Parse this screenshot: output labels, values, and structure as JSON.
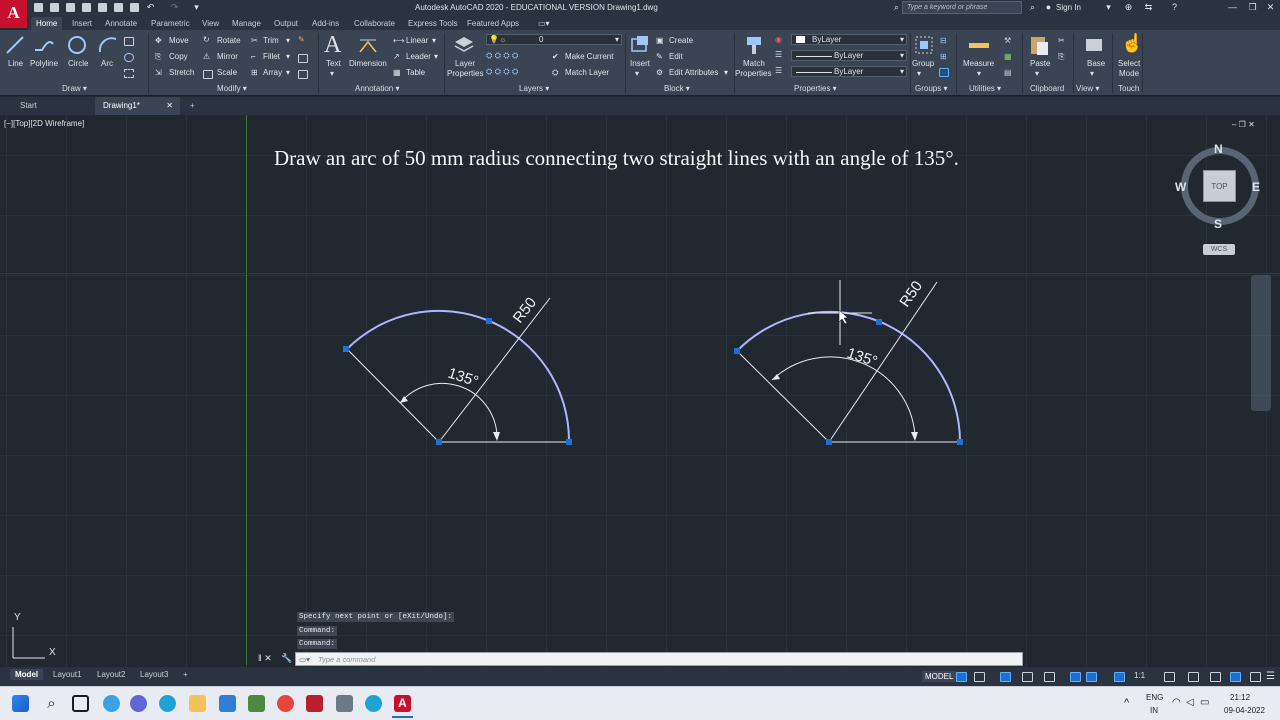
{
  "window": {
    "title": "Autodesk AutoCAD 2020 - EDUCATIONAL VERSION    Drawing1.dwg",
    "search_placeholder": "Type a keyword or phrase",
    "sign_in": "Sign In",
    "logo": "A"
  },
  "ribbon_tabs": [
    "Home",
    "Insert",
    "Annotate",
    "Parametric",
    "View",
    "Manage",
    "Output",
    "Add-ins",
    "Collaborate",
    "Express Tools",
    "Featured Apps"
  ],
  "ribbon": {
    "draw": {
      "line": "Line",
      "polyline": "Polyline",
      "circle": "Circle",
      "arc": "Arc",
      "panel": "Draw ▾"
    },
    "modify": {
      "move": "Move",
      "rotate": "Rotate",
      "trim": "Trim",
      "copy": "Copy",
      "mirror": "Mirror",
      "fillet": "Fillet",
      "stretch": "Stretch",
      "scale": "Scale",
      "array": "Array",
      "panel": "Modify ▾"
    },
    "annotation": {
      "text": "Text",
      "dimension": "Dimension",
      "linear": "Linear",
      "leader": "Leader",
      "table": "Table",
      "panel": "Annotation ▾"
    },
    "layers": {
      "layer_properties_1": "Layer",
      "layer_properties_2": "Properties",
      "layer_value": "0",
      "make_current": "Make Current",
      "match_layer": "Match Layer",
      "panel": "Layers ▾"
    },
    "block": {
      "insert": "Insert",
      "create": "Create",
      "edit": "Edit",
      "edit_attributes": "Edit Attributes",
      "panel": "Block ▾"
    },
    "properties": {
      "match_1": "Match",
      "match_2": "Properties",
      "color": "ByLayer",
      "linetype": "ByLayer",
      "lineweight": "ByLayer",
      "panel": "Properties ▾"
    },
    "groups": {
      "group": "Group",
      "panel": "Groups ▾"
    },
    "utilities": {
      "measure": "Measure",
      "panel": "Utilities ▾"
    },
    "clipboard": {
      "paste": "Paste",
      "panel": "Clipboard"
    },
    "view": {
      "base": "Base",
      "panel": "View ▾"
    },
    "touch": {
      "select_1": "Select",
      "select_2": "Mode",
      "panel": "Touch"
    }
  },
  "file_tabs": {
    "start": "Start",
    "drawing": "Drawing1*",
    "close": "✕",
    "add": "+"
  },
  "viewport": {
    "label": "[−][Top][2D Wireframe]",
    "task": "Draw an arc of 50 mm radius connecting two straight lines with an angle of 135°.",
    "viewcube": {
      "north": "N",
      "south": "S",
      "east": "E",
      "west": "W",
      "top": "TOP",
      "wcs": "WCS"
    },
    "ucs_y": "Y",
    "ucs_x": "X"
  },
  "drawing": {
    "left_radius": "R50",
    "left_angle": "135°",
    "right_radius": "R50",
    "right_angle": "135°"
  },
  "command": {
    "line1": "Specify next point or [eXit/Undo]:",
    "line2": "Command:",
    "line3": "Command:",
    "placeholder": "Type a command"
  },
  "layout_tabs": [
    "Model",
    "Layout1",
    "Layout2",
    "Layout3"
  ],
  "status": {
    "model": "MODEL",
    "scale": "1:1"
  },
  "taskbar": {
    "lang1": "ENG",
    "lang2": "IN",
    "time": "21:12",
    "date": "09-04-2022"
  },
  "colors": {
    "accent_blue": "#1e6fd0",
    "arc": "#aeb6ff",
    "grip": "#1f6fd6",
    "autocad_red": "#c8102e"
  }
}
